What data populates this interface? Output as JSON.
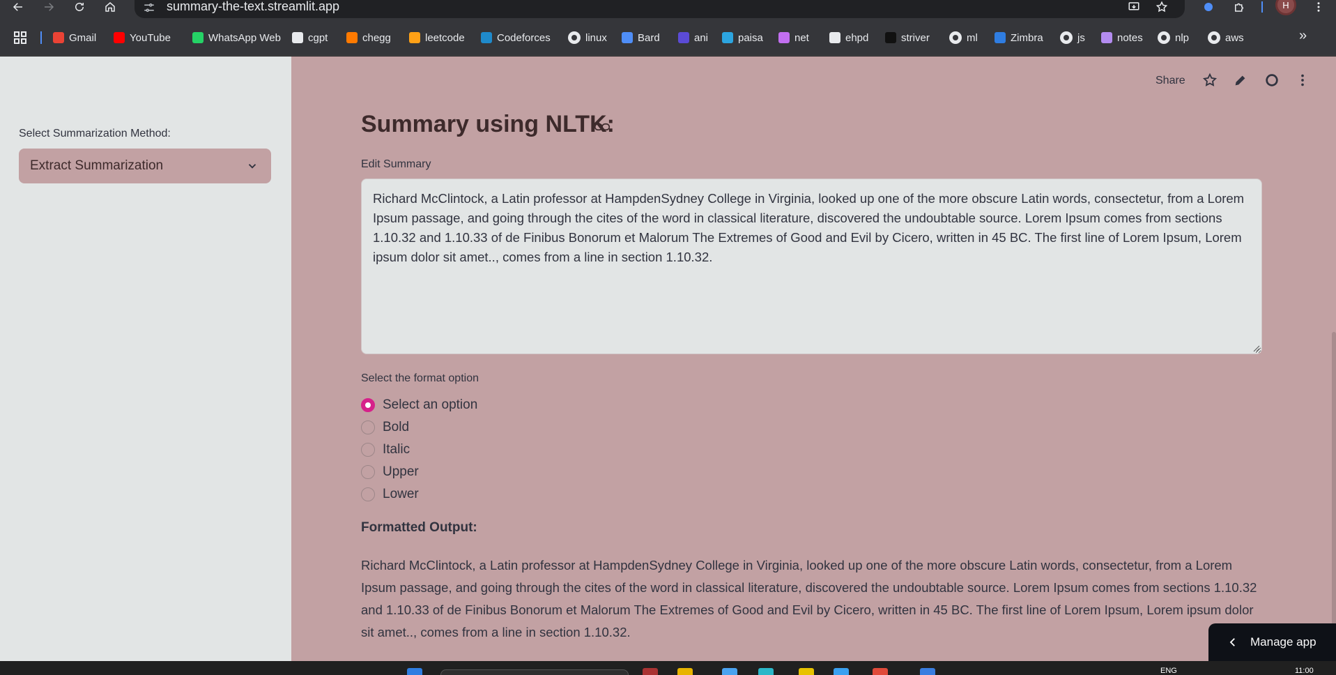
{
  "browser": {
    "url": "summary-the-text.streamlit.app",
    "profile_initial": "H",
    "bookmarks": [
      {
        "label": "Gmail",
        "icon": "gmail-icon",
        "color": "#ea4335"
      },
      {
        "label": "YouTube",
        "icon": "youtube-icon",
        "color": "#ff0000"
      },
      {
        "label": "WhatsApp Web",
        "icon": "whatsapp-icon",
        "color": "#25d366"
      },
      {
        "label": "cgpt",
        "icon": "chatgpt-icon",
        "color": "#e8eaed"
      },
      {
        "label": "chegg",
        "icon": "chegg-icon",
        "color": "#ff7a00"
      },
      {
        "label": "leetcode",
        "icon": "leetcode-icon",
        "color": "#ffa116"
      },
      {
        "label": "Codeforces",
        "icon": "codeforces-icon",
        "color": "#1f8acb"
      },
      {
        "label": "linux",
        "icon": "github-icon",
        "color": "#e8eaed"
      },
      {
        "label": "Bard",
        "icon": "bard-icon",
        "color": "#4f8ef7"
      },
      {
        "label": "ani",
        "icon": "hianime-icon",
        "color": "#5b4bd6"
      },
      {
        "label": "paisa",
        "icon": "paisa-icon",
        "color": "#2ca5e0"
      },
      {
        "label": "net",
        "icon": "umbrella-icon",
        "color": "#c26ff0"
      },
      {
        "label": "ehpd",
        "icon": "ehpd-icon",
        "color": "#e8eaed"
      },
      {
        "label": "striver",
        "icon": "tuf-icon",
        "color": "#111111"
      },
      {
        "label": "ml",
        "icon": "github-icon",
        "color": "#e8eaed"
      },
      {
        "label": "Zimbra",
        "icon": "zimbra-icon",
        "color": "#2f7de1"
      },
      {
        "label": "js",
        "icon": "github-icon",
        "color": "#e8eaed"
      },
      {
        "label": "notes",
        "icon": "notes-icon",
        "color": "#b38cf0"
      },
      {
        "label": "nlp",
        "icon": "github-icon",
        "color": "#e8eaed"
      },
      {
        "label": "aws",
        "icon": "github-icon",
        "color": "#e8eaed"
      }
    ],
    "overflow_glyph": "»"
  },
  "sidebar": {
    "method_label": "Select Summarization Method:",
    "method_value": "Extract Summarization"
  },
  "header": {
    "share_label": "Share"
  },
  "main": {
    "title": "Summary using NLTK:",
    "edit_label": "Edit Summary",
    "summary_text": "Richard McClintock, a Latin professor at HampdenSydney College in Virginia, looked up one of the more obscure Latin words, consectetur, from a Lorem Ipsum passage, and going through the cites of the word in classical literature, discovered the undoubtable source. Lorem Ipsum comes from sections 1.10.32 and 1.10.33 of de Finibus Bonorum et Malorum The Extremes of Good and Evil by Cicero, written in 45 BC. The first line of Lorem Ipsum, Lorem ipsum dolor sit amet.., comes from a line in section 1.10.32.",
    "format_label": "Select the format option",
    "format_options": [
      "Select an option",
      "Bold",
      "Italic",
      "Upper",
      "Lower"
    ],
    "selected_option": "Select an option",
    "output_heading": "Formatted Output:",
    "output_text": "Richard McClintock, a Latin professor at HampdenSydney College in Virginia, looked up one of the more obscure Latin words, consectetur, from a Lorem Ipsum passage, and going through the cites of the word in classical literature, discovered the undoubtable source. Lorem Ipsum comes from sections 1.10.32 and 1.10.33 of de Finibus Bonorum et Malorum The Extremes of Good and Evil by Cicero, written in 45 BC. The first line of Lorem Ipsum, Lorem ipsum dolor sit amet.., comes from a line in section 1.10.32."
  },
  "manage_app_label": "Manage app",
  "taskbar": {
    "lang": "ENG",
    "time": "11:00"
  },
  "colors": {
    "accent": "#d6218a",
    "main_bg": "#c2a1a3",
    "sidebar_bg": "#e2e5e5"
  }
}
